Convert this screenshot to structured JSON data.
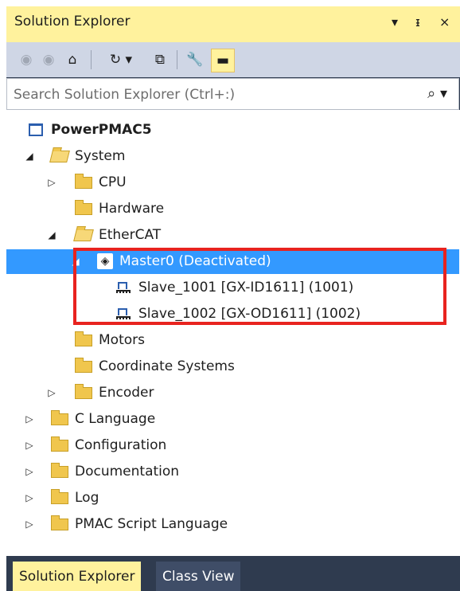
{
  "window": {
    "title": "Solution Explorer",
    "dropdown_glyph": "▾",
    "pin_glyph": "ᵻ",
    "close_glyph": "×"
  },
  "toolbar": {
    "back_glyph": "◉",
    "forward_glyph": "◉",
    "home_glyph": "⌂",
    "sync_glyph": "↻ ▾",
    "collapse_glyph": "⧉",
    "properties_glyph": "🔧",
    "preview_glyph": "▬"
  },
  "search": {
    "placeholder": "Search Solution Explorer (Ctrl+:)",
    "icon_glyph": "⌕ ▾"
  },
  "tree": {
    "project": "PowerPMAC5",
    "system": "System",
    "cpu": "CPU",
    "hardware": "Hardware",
    "ethercat": "EtherCAT",
    "master": "Master0 (Deactivated)",
    "slave1": "Slave_1001 [GX-ID1611] (1001)",
    "slave2": "Slave_1002 [GX-OD1611] (1002)",
    "motors": "Motors",
    "coord": "Coordinate Systems",
    "encoder": "Encoder",
    "clang": "C Language",
    "configuration": "Configuration",
    "documentation": "Documentation",
    "log": "Log",
    "pmac_script": "PMAC Script Language",
    "expanded_glyph": "◢",
    "collapsed_glyph": "▷"
  },
  "tabs": {
    "solution_explorer": "Solution Explorer",
    "class_view": "Class View"
  },
  "colors": {
    "title_bg": "#fff29d",
    "toolbar_bg": "#cfd6e5",
    "selection": "#3399ff",
    "highlight_border": "#e8231f",
    "frame": "#2f3b4f"
  }
}
